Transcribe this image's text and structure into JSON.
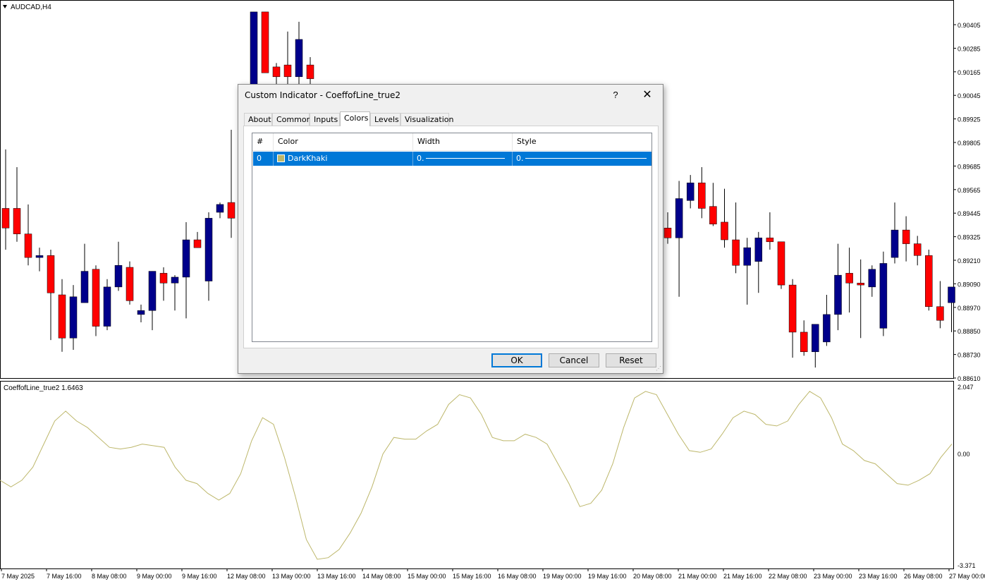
{
  "symbol_label": "AUDCAD,H4",
  "indicator_label": "CoeffofLine_true2 1.6463",
  "price_axis": [
    "0.90405",
    "0.90285",
    "0.90165",
    "0.90045",
    "0.89925",
    "0.89805",
    "0.89685",
    "0.89565",
    "0.89445",
    "0.89325",
    "0.89210",
    "0.89090",
    "0.88970",
    "0.88850",
    "0.88730",
    "0.88610"
  ],
  "indicator_axis": [
    "2.047",
    "0.00",
    "-3.371"
  ],
  "time_axis": [
    "7 May 2025",
    "7 May 16:00",
    "8 May 08:00",
    "9 May 00:00",
    "9 May 16:00",
    "12 May 08:00",
    "13 May 00:00",
    "13 May 16:00",
    "14 May 08:00",
    "15 May 00:00",
    "15 May 16:00",
    "16 May 08:00",
    "19 May 00:00",
    "19 May 16:00",
    "20 May 08:00",
    "21 May 00:00",
    "21 May 16:00",
    "22 May 08:00",
    "23 May 00:00",
    "23 May 16:00",
    "26 May 08:00",
    "27 May 00:00"
  ],
  "colors": {
    "bull": "#00008b",
    "bear": "#ff0000",
    "indicator_line": "#bdb76b",
    "selection": "#0078d7"
  },
  "dialog": {
    "title": "Custom Indicator - CoeffofLine_true2",
    "help": "?",
    "close": "✕",
    "tabs": [
      "About",
      "Common",
      "Inputs",
      "Colors",
      "Levels",
      "Visualization"
    ],
    "active_tab": "Colors",
    "table": {
      "headers": [
        "#",
        "Color",
        "Width",
        "Style"
      ],
      "rows": [
        {
          "index": "0",
          "color_name": "DarkKhaki",
          "color": "#bdb76b",
          "width": "0.",
          "style": "0."
        }
      ]
    },
    "buttons": {
      "ok": "OK",
      "cancel": "Cancel",
      "reset": "Reset"
    }
  },
  "chart_data": [
    {
      "type": "candlestick",
      "title": "AUDCAD,H4",
      "ylim": [
        0.8861,
        0.9046
      ],
      "candles": [
        {
          "o": 0.8947,
          "h": 0.8977,
          "l": 0.8926,
          "c": 0.8937
        },
        {
          "o": 0.8947,
          "h": 0.8968,
          "l": 0.893,
          "c": 0.8934
        },
        {
          "o": 0.8934,
          "h": 0.8949,
          "l": 0.8918,
          "c": 0.8922
        },
        {
          "o": 0.8922,
          "h": 0.8927,
          "l": 0.8915,
          "c": 0.8923
        },
        {
          "o": 0.8923,
          "h": 0.8926,
          "l": 0.888,
          "c": 0.8904
        },
        {
          "o": 0.8903,
          "h": 0.8911,
          "l": 0.8874,
          "c": 0.8881
        },
        {
          "o": 0.8881,
          "h": 0.8908,
          "l": 0.8875,
          "c": 0.8902
        },
        {
          "o": 0.8899,
          "h": 0.8929,
          "l": 0.8899,
          "c": 0.8915
        },
        {
          "o": 0.8916,
          "h": 0.8918,
          "l": 0.8882,
          "c": 0.8887
        },
        {
          "o": 0.8887,
          "h": 0.8911,
          "l": 0.8885,
          "c": 0.8907
        },
        {
          "o": 0.8907,
          "h": 0.893,
          "l": 0.8905,
          "c": 0.8918
        },
        {
          "o": 0.8917,
          "h": 0.892,
          "l": 0.8898,
          "c": 0.89
        },
        {
          "o": 0.8893,
          "h": 0.8898,
          "l": 0.8889,
          "c": 0.8895
        },
        {
          "o": 0.8895,
          "h": 0.8915,
          "l": 0.8885,
          "c": 0.8915
        },
        {
          "o": 0.8914,
          "h": 0.8917,
          "l": 0.89,
          "c": 0.8909
        },
        {
          "o": 0.8909,
          "h": 0.8913,
          "l": 0.8895,
          "c": 0.8912
        },
        {
          "o": 0.8912,
          "h": 0.894,
          "l": 0.8891,
          "c": 0.8931
        },
        {
          "o": 0.8931,
          "h": 0.8935,
          "l": 0.8927,
          "c": 0.8927
        },
        {
          "o": 0.891,
          "h": 0.8945,
          "l": 0.89,
          "c": 0.8942
        },
        {
          "o": 0.8945,
          "h": 0.895,
          "l": 0.8942,
          "c": 0.8949
        },
        {
          "o": 0.895,
          "h": 0.8987,
          "l": 0.8932,
          "c": 0.8942
        },
        {
          "o": 0.8942,
          "h": 0.895,
          "l": 0.8919,
          "c": 0.8937
        },
        {
          "o": 0.9008,
          "h": 0.902,
          "l": 0.898,
          "c": 0.9047
        },
        {
          "o": 0.9047,
          "h": 0.9018,
          "l": 0.9016,
          "c": 0.9016
        },
        {
          "o": 0.9019,
          "h": 0.9021,
          "l": 0.9008,
          "c": 0.9014
        },
        {
          "o": 0.902,
          "h": 0.9037,
          "l": 0.901,
          "c": 0.9014
        },
        {
          "o": 0.9014,
          "h": 0.9042,
          "l": 0.9008,
          "c": 0.9033
        },
        {
          "o": 0.902,
          "h": 0.9024,
          "l": 0.9008,
          "c": 0.9013
        }
      ]
    },
    {
      "type": "line",
      "title": "CoeffofLine_true2 1.6463",
      "ylim": [
        -3.371,
        2.047
      ],
      "values": [
        -0.8,
        -1.0,
        -0.8,
        -0.4,
        0.3,
        1.0,
        1.3,
        1.0,
        0.8,
        0.5,
        0.2,
        0.15,
        0.2,
        0.3,
        0.25,
        0.2,
        -0.4,
        -0.8,
        -0.9,
        -1.2,
        -1.4,
        -1.2,
        -0.6,
        0.4,
        1.1,
        0.9,
        -0.1,
        -1.3,
        -2.6,
        -3.2,
        -3.15,
        -2.9,
        -2.4,
        -1.8,
        -1.0,
        0.0,
        0.5,
        0.45,
        0.45,
        0.7,
        0.9,
        1.5,
        1.8,
        1.7,
        1.2,
        0.5,
        0.4,
        0.4,
        0.6,
        0.5,
        0.3,
        -0.3,
        -0.9,
        -1.6,
        -1.5,
        -1.1,
        -0.3,
        0.8,
        1.7,
        1.9,
        1.8,
        1.2,
        0.6,
        0.1,
        0.05,
        0.15,
        0.6,
        1.1,
        1.3,
        1.2,
        0.9,
        0.85,
        1.0,
        1.5,
        1.9,
        1.7,
        1.1,
        0.3,
        0.1,
        -0.2,
        -0.3,
        -0.6,
        -0.9,
        -0.95,
        -0.8,
        -0.6,
        -0.1,
        0.3
      ]
    }
  ]
}
